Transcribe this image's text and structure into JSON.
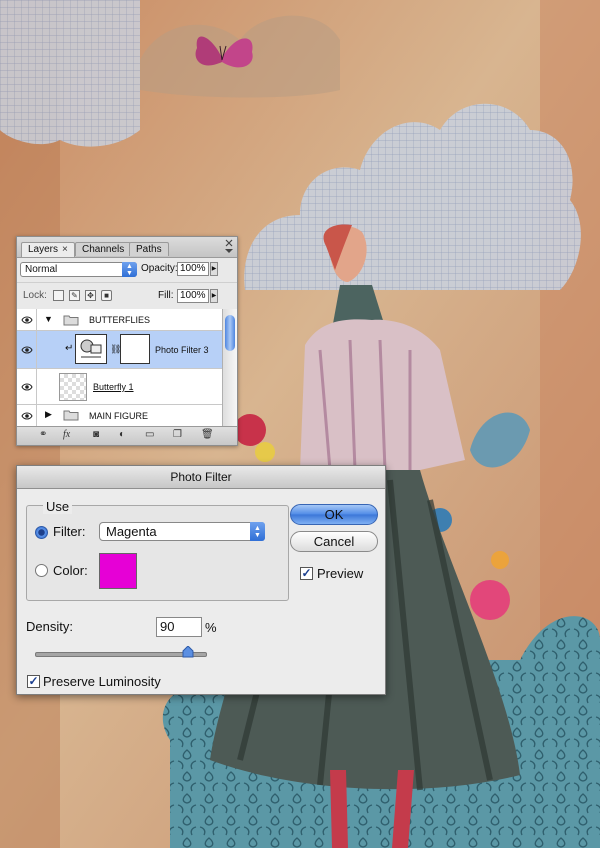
{
  "layers_panel": {
    "tabs": [
      "Layers",
      "Channels",
      "Paths"
    ],
    "tab_close_glyph": "×",
    "blend_mode": "Normal",
    "opacity_label": "Opacity:",
    "opacity_value": "100%",
    "lock_label": "Lock:",
    "fill_label": "Fill:",
    "fill_value": "100%",
    "layers": [
      {
        "name": "BUTTERFLIES",
        "kind": "group",
        "expanded": true,
        "visible": true
      },
      {
        "name": "Photo Filter 3",
        "kind": "adjustment",
        "selected": true,
        "visible": true
      },
      {
        "name": "Butterfly 1",
        "kind": "pixel",
        "visible": true
      },
      {
        "name": "MAIN FIGURE",
        "kind": "group",
        "expanded": false,
        "visible": true
      }
    ],
    "footer_icons": [
      "link-icon",
      "fx-icon",
      "mask-icon",
      "adjustment-icon",
      "folder-icon",
      "new-layer-icon",
      "trash-icon"
    ],
    "fx_label": "fx"
  },
  "photo_filter": {
    "title": "Photo Filter",
    "use_label": "Use",
    "filter_label": "Filter:",
    "filter_value": "Magenta",
    "filter_selected": true,
    "color_label": "Color:",
    "color_swatch": "#e600d6",
    "ok_label": "OK",
    "cancel_label": "Cancel",
    "preview_label": "Preview",
    "preview_checked": true,
    "density_label": "Density:",
    "density_value": "90",
    "density_unit": "%",
    "density_percent": 90,
    "preserve_label": "Preserve Luminosity",
    "preserve_checked": true,
    "accent": "#3b76d8"
  }
}
